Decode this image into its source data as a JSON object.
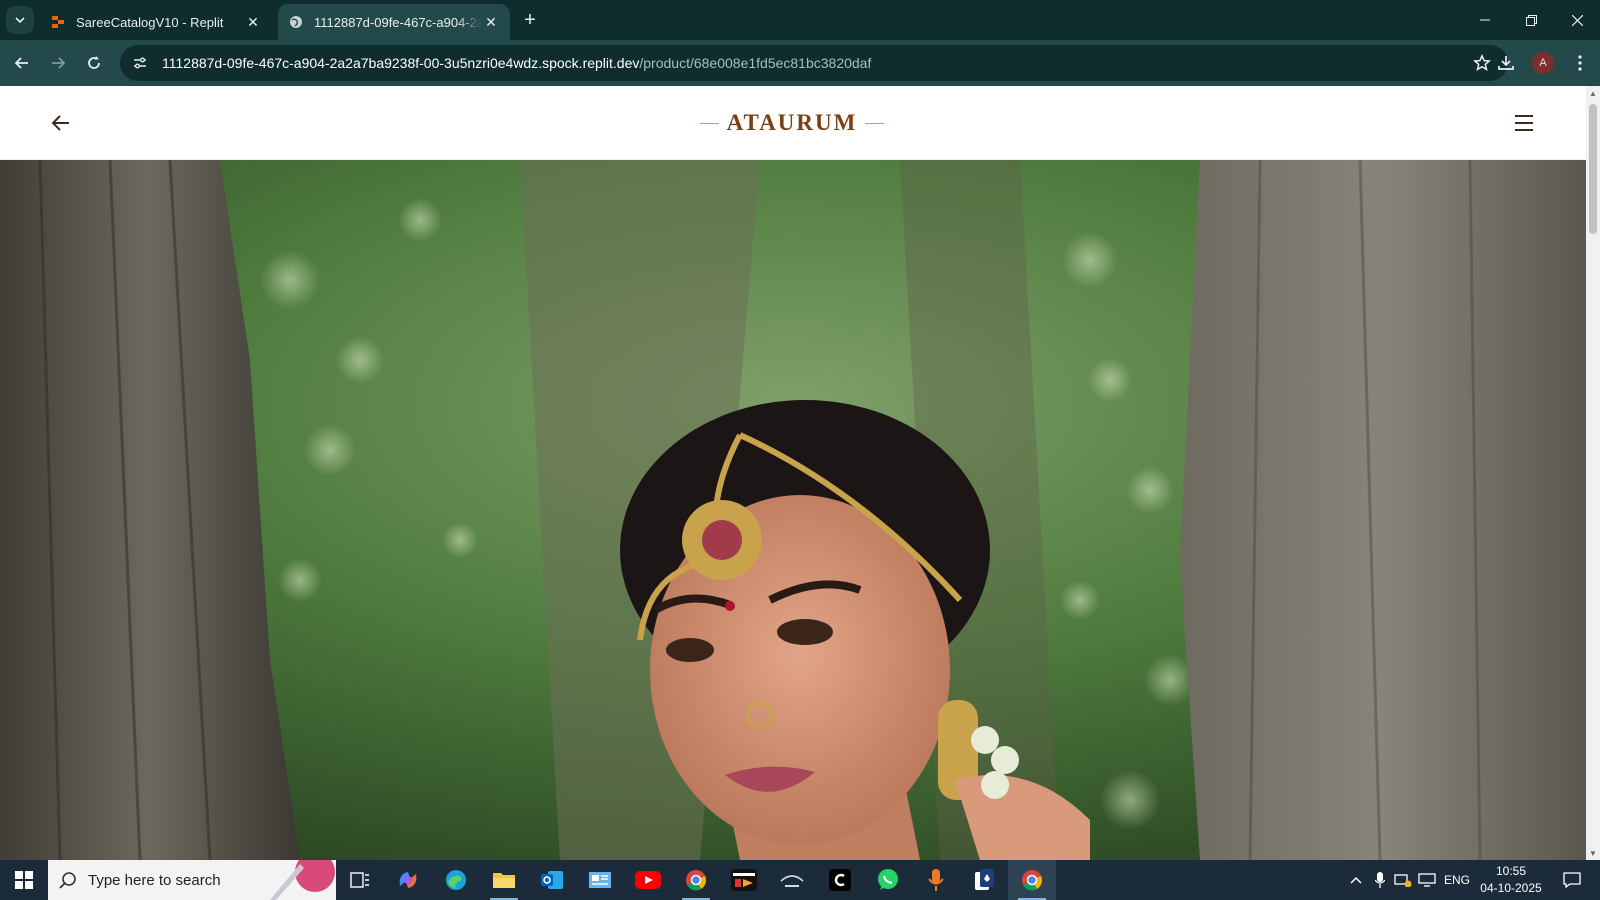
{
  "browser": {
    "tabs": [
      {
        "title": "SareeCatalogV10 - Replit",
        "favicon": "replit-icon",
        "active": false
      },
      {
        "title": "1112887d-09fe-467c-a904-2a2a",
        "favicon": "globe-icon",
        "active": true
      }
    ],
    "url_host": "1112887d-09fe-467c-a904-2a2a7ba9238f-00-3u5nzri0e4wdz.spock.replit.dev",
    "url_path": "/product/68e008e1fd5ec81bc3820daf",
    "profile_initial": "A",
    "colors": {
      "frame": "#0f2d2d",
      "toolbar": "#24494a"
    }
  },
  "site": {
    "brand": "ATAURUM",
    "colors": {
      "brand": "#7a3f14",
      "rule": "#c9a24c"
    },
    "hero_image": "product-model-photo"
  },
  "taskbar": {
    "search_placeholder": "Type here to search",
    "language": "ENG",
    "time": "10:55",
    "date": "04-10-2025",
    "apps": [
      "task-view-icon",
      "copilot-icon",
      "edge-icon",
      "file-explorer-icon",
      "outlook-icon",
      "news-icon",
      "youtube-icon",
      "chrome-profile-icon",
      "sonyliv-icon",
      "hotstar-icon",
      "c-app-icon",
      "whatsapp-icon",
      "voice-recorder-icon",
      "solitaire-icon",
      "chrome-icon"
    ]
  }
}
